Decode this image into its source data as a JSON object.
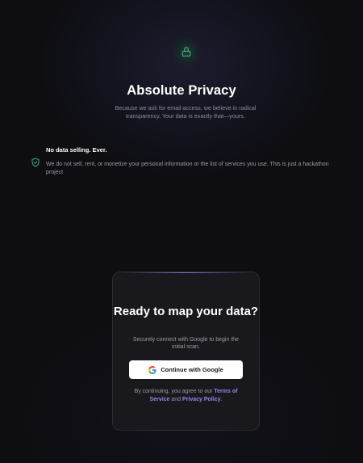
{
  "hero": {
    "icon": "lock-icon",
    "title": "Absolute Privacy",
    "subtitle": "Because we ask for email access, we believe in radical transparency. Your data is exactly that—yours."
  },
  "feature": {
    "icon": "shield-check-icon",
    "title": "No data selling. Ever.",
    "text": "We do not sell, rent, or monetize your personal information or the list of services you use. This is just a hackathon project"
  },
  "card": {
    "title": "Ready to map your data?",
    "subtitle": "Securely connect with Google to begin the initial scan.",
    "google_button_label": "Continue with Google",
    "legal_prefix": "By continuing, you agree to our ",
    "terms_link": "Terms of Service",
    "legal_and": " and ",
    "privacy_link": "Privacy Policy",
    "legal_suffix": "."
  },
  "colors": {
    "background": "#0d0d12",
    "card": "#18181d",
    "accent_green": "#3fae72",
    "link_purple": "#9b82f0"
  }
}
